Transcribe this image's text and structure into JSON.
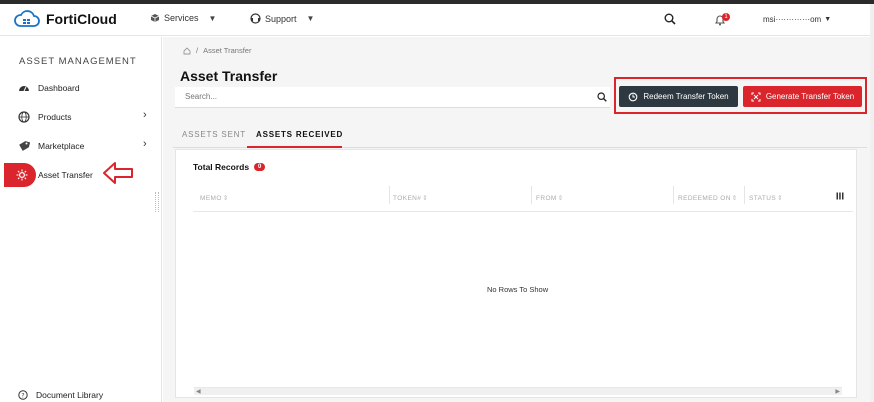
{
  "header": {
    "logo_text": "FortiCloud",
    "services_label": "Services",
    "support_label": "Support",
    "notification_count": "1",
    "user_email": "msi·············om"
  },
  "sidebar": {
    "title": "ASSET MANAGEMENT",
    "items": [
      {
        "label": "Dashboard",
        "icon": "dashboard-gauge-icon"
      },
      {
        "label": "Products",
        "icon": "products-globe-icon"
      },
      {
        "label": "Marketplace",
        "icon": "marketplace-tag-icon"
      },
      {
        "label": "Asset Transfer",
        "icon": "asset-transfer-icon"
      }
    ],
    "active_item": "Asset Transfer",
    "document_library": "Document Library"
  },
  "breadcrumb": {
    "current": "Asset Transfer"
  },
  "page": {
    "title": "Asset Transfer",
    "search_placeholder": "Search..."
  },
  "actions": {
    "redeem_label": "Redeem Transfer Token",
    "generate_label": "Generate Transfer Token"
  },
  "tabs": [
    {
      "label": "ASSETS SENT",
      "active": false
    },
    {
      "label": "ASSETS RECEIVED",
      "active": true
    }
  ],
  "grid": {
    "total_label": "Total Records",
    "total_count": "0",
    "columns": [
      "MEMO",
      "TOKEN#",
      "FROM",
      "REDEEMED ON",
      "STATUS"
    ],
    "empty_message": "No Rows To Show"
  },
  "colors": {
    "accent": "#d9252b",
    "dark_button": "#2d3840"
  }
}
